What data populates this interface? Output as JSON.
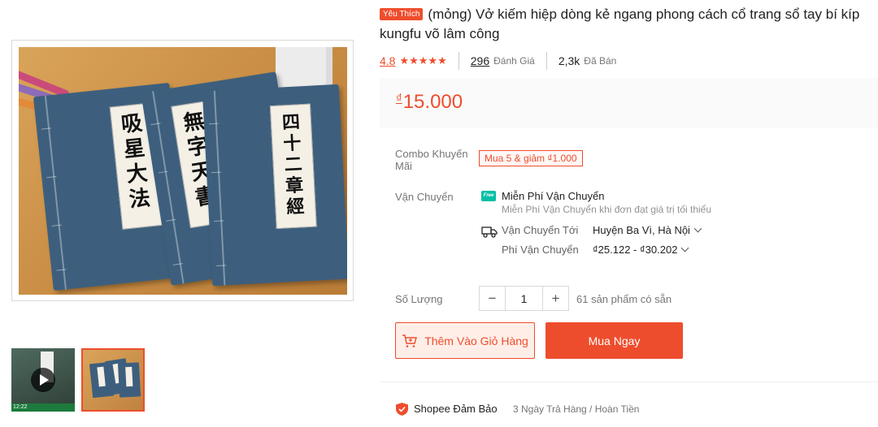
{
  "product": {
    "badge": "Yêu Thích",
    "title": "(mỏng) Vở kiếm hiệp dòng kẻ ngang phong cách cổ trang sổ tay bí kíp kungfu võ lâm công"
  },
  "rating": {
    "score": "4.8",
    "stars": "★★★★★",
    "reviews_count": "296",
    "reviews_label": "Đánh Giá",
    "sold_count": "2,3k",
    "sold_label": "Đã Bán"
  },
  "price": {
    "currency": "₫",
    "value": "15.000"
  },
  "combo": {
    "label": "Combo Khuyến Mãi",
    "tag": "Mua 5 & giảm ₫1.000"
  },
  "shipping": {
    "label": "Vận Chuyển",
    "free_icon_text": "Free",
    "free_title": "Miễn Phí Vận Chuyển",
    "free_sub": "Miễn Phí Vận Chuyển khi đơn đạt giá trị tối thiểu",
    "to_label": "Vận Chuyển Tới",
    "to_value": "Huyện Ba Vì, Hà Nội",
    "fee_label": "Phí Vận Chuyển",
    "fee_value": "₫25.122 - ₫30.202"
  },
  "quantity": {
    "label": "Số Lượng",
    "minus": "−",
    "value": "1",
    "plus": "+",
    "stock": "61 sản phẩm có sẵn"
  },
  "actions": {
    "add_to_cart": "Thêm Vào Giỏ Hàng",
    "buy_now": "Mua Ngay"
  },
  "guarantee": {
    "title": "Shopee Đảm Bảo",
    "text": "3 Ngày Trả Hàng / Hoàn Tiền"
  },
  "gallery": {
    "book_titles": [
      "吸星大法",
      "無字天書",
      "四十二章經"
    ],
    "video_time": "12:22"
  },
  "colors": {
    "accent": "#ee4d2d",
    "price_bg": "#fafafa",
    "free_ship": "#00bfa5",
    "book_blue": "#3d5f7d"
  }
}
